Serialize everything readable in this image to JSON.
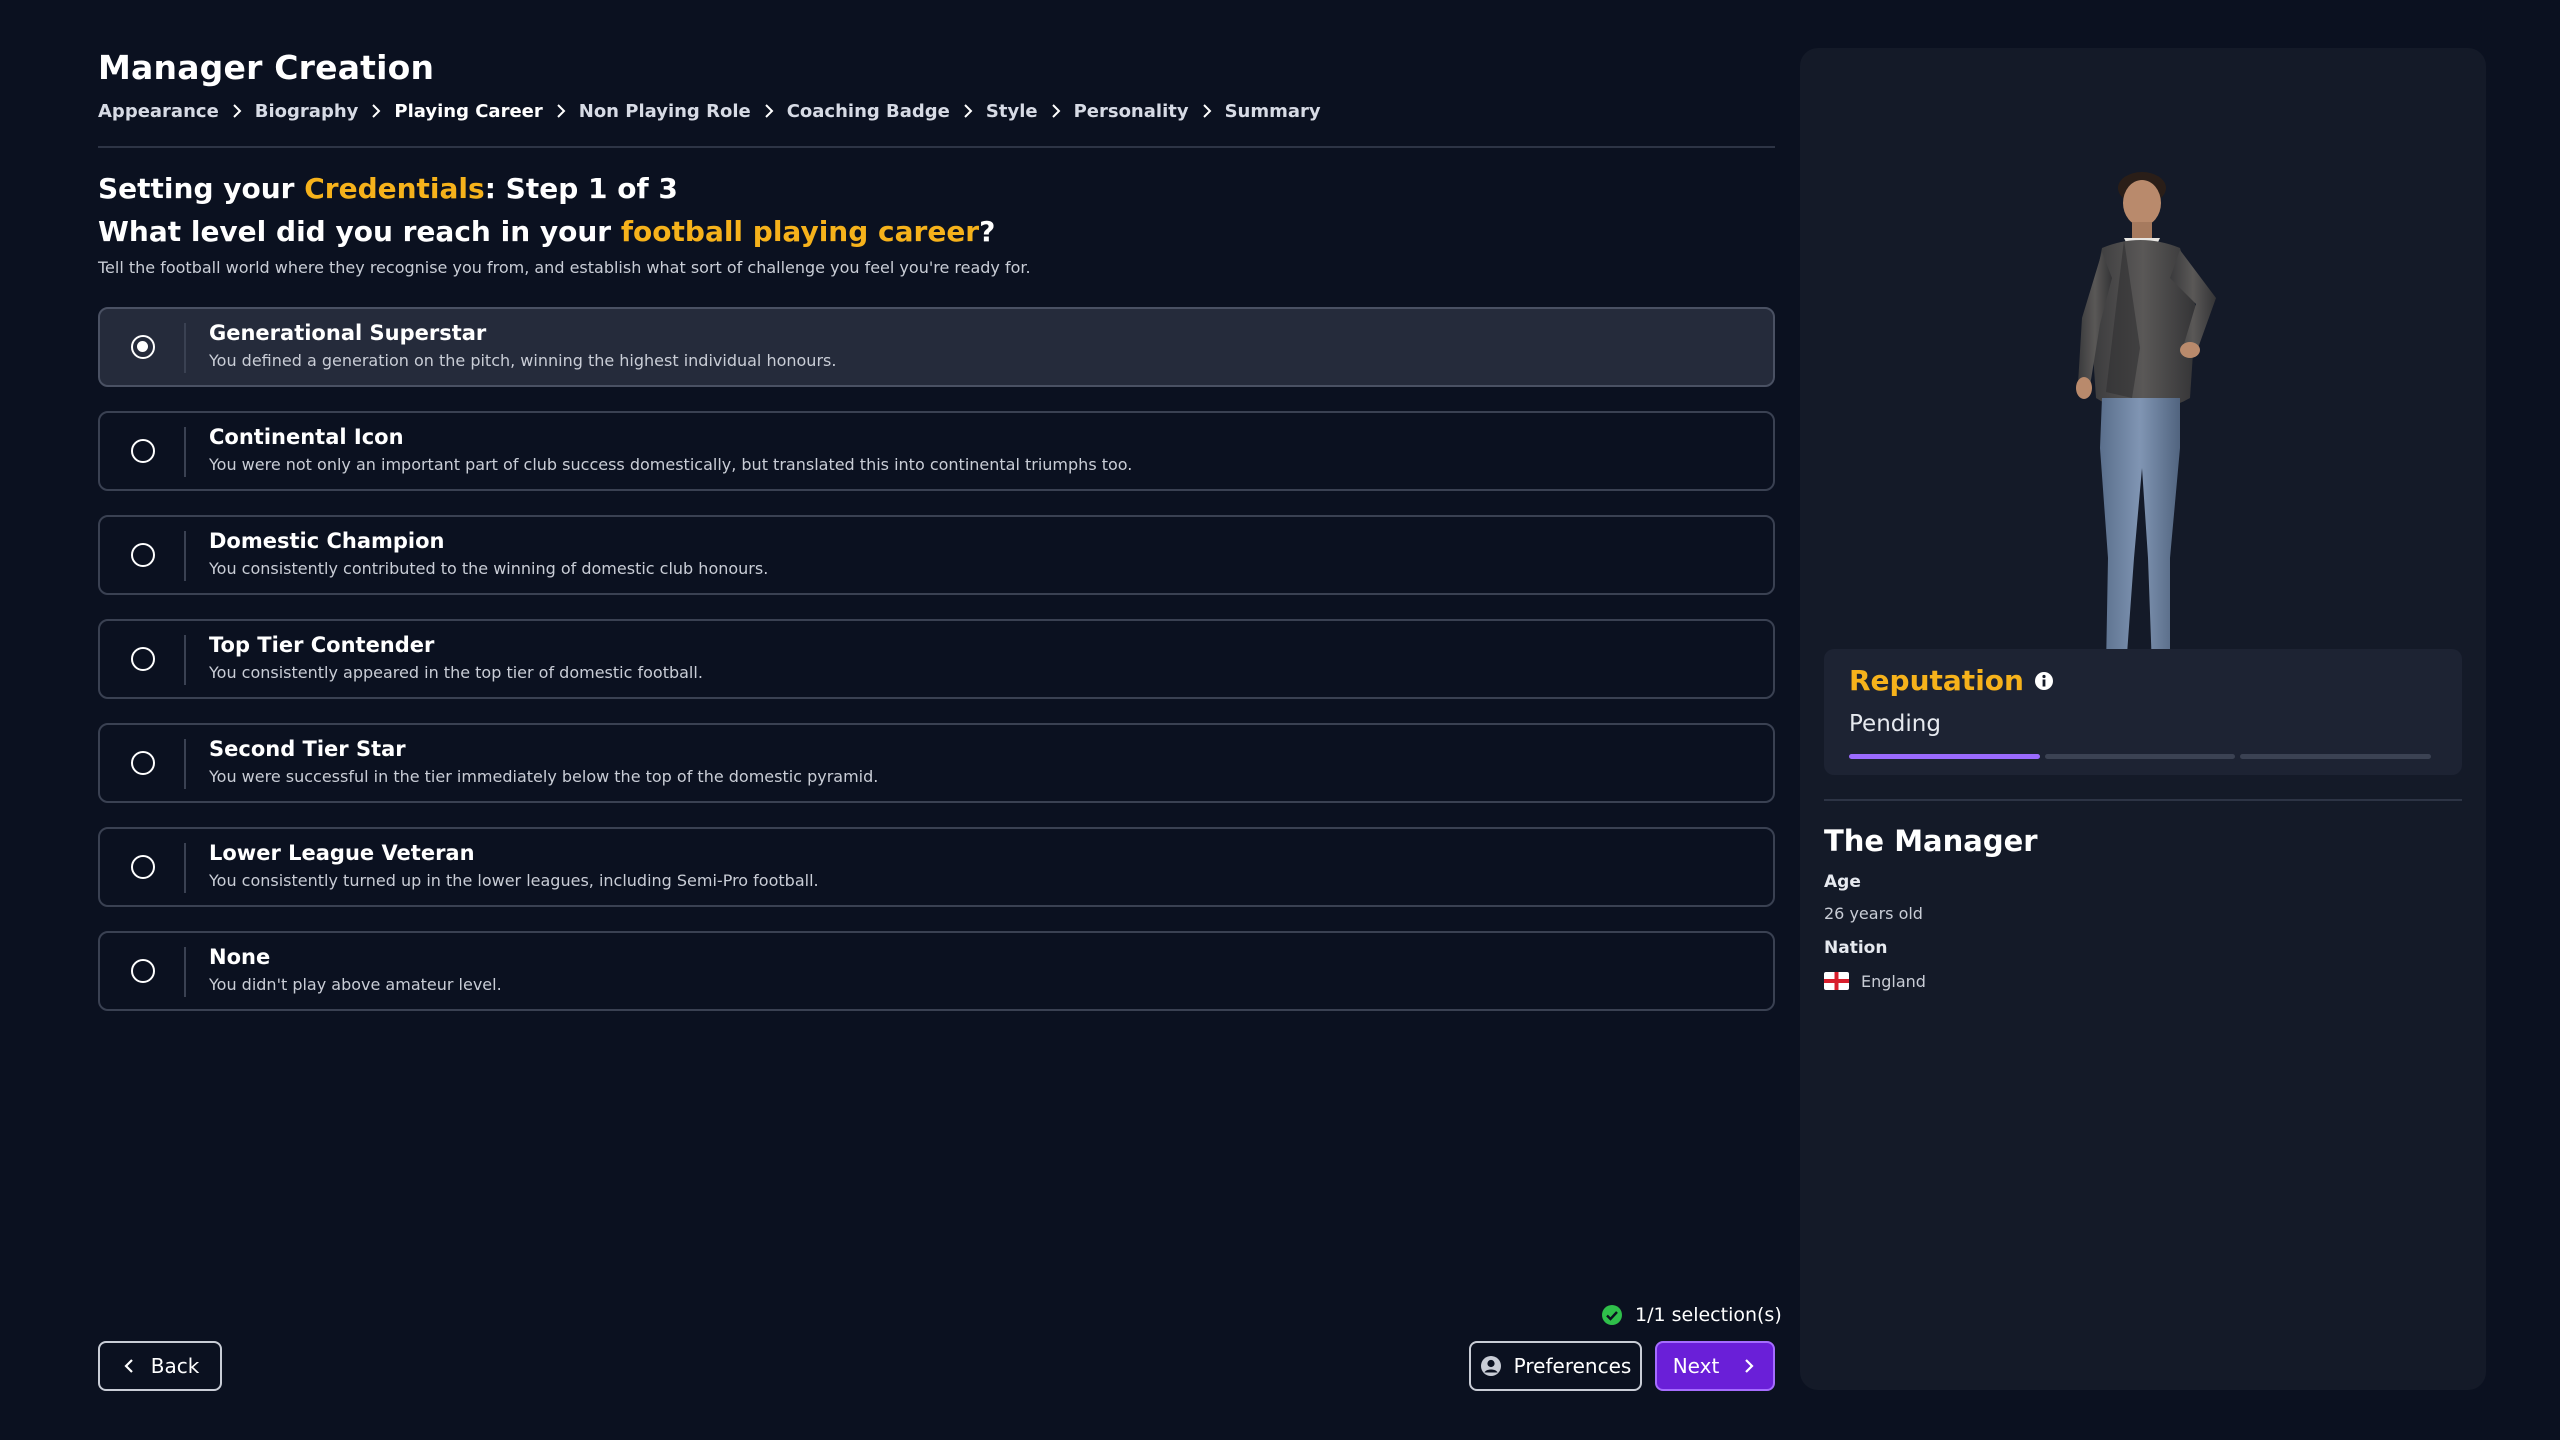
{
  "header": {
    "title": "Manager Creation",
    "breadcrumb": [
      {
        "label": "Appearance"
      },
      {
        "label": "Biography"
      },
      {
        "label": "Playing Career"
      },
      {
        "label": "Non Playing Role"
      },
      {
        "label": "Coaching Badge"
      },
      {
        "label": "Style"
      },
      {
        "label": "Personality"
      },
      {
        "label": "Summary"
      }
    ],
    "active_crumb": "Playing Career"
  },
  "step": {
    "prefix": "Setting your",
    "highlight": "Credentials",
    "suffix": ": Step 1 of 3"
  },
  "question": {
    "prefix": "What level did you reach in your",
    "highlight": "football playing career",
    "suffix": "?"
  },
  "subtitle": "Tell the football world where they recognise you from, and establish what sort of challenge you feel you're ready for.",
  "options": [
    {
      "title": "Generational Superstar",
      "desc": "You defined a generation on the pitch, winning the highest individual honours.",
      "selected": true
    },
    {
      "title": "Continental Icon",
      "desc": "You were not only an important part of club success domestically, but translated this into continental triumphs too.",
      "selected": false
    },
    {
      "title": "Domestic Champion",
      "desc": "You consistently contributed to the winning of domestic club honours.",
      "selected": false
    },
    {
      "title": "Top Tier Contender",
      "desc": "You consistently appeared in the top tier of domestic football.",
      "selected": false
    },
    {
      "title": "Second Tier Star",
      "desc": "You were successful in the tier immediately below the top of the domestic pyramid.",
      "selected": false
    },
    {
      "title": "Lower League Veteran",
      "desc": "You consistently turned up in the lower leagues, including Semi-Pro football.",
      "selected": false
    },
    {
      "title": "None",
      "desc": "You didn't play above amateur level.",
      "selected": false
    }
  ],
  "selection_status": "1/1 selection(s)",
  "buttons": {
    "back": "Back",
    "preferences": "Preferences",
    "next": "Next"
  },
  "reputation": {
    "title": "Reputation",
    "status": "Pending",
    "segments_total": 3,
    "segments_filled": 1
  },
  "manager": {
    "title": "The Manager",
    "age_label": "Age",
    "age_value": "26 years old",
    "nation_label": "Nation",
    "nation_value": "England"
  },
  "icons": {
    "breadcrumb_separator": "chevron-right-icon",
    "selection_ok": "check-circle-icon",
    "back": "chevron-left-icon",
    "preferences": "user-circle-icon",
    "next": "chevron-right-icon",
    "reputation_info": "info-icon",
    "nation_flag": "england-flag-icon"
  },
  "colors": {
    "background": "#0b1120",
    "panel": "#141a28",
    "accent": "#f6b21b",
    "primary_button": "#6a1fd8",
    "reputation_fill": "#9b6bff",
    "success": "#2fbf4a"
  }
}
